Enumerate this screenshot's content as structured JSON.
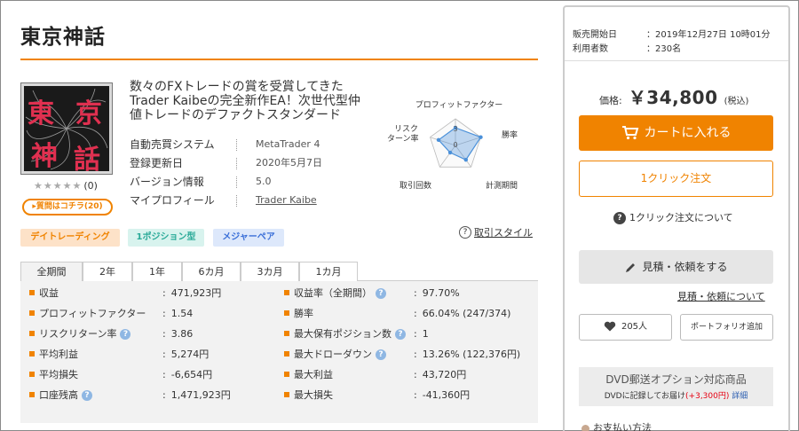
{
  "product": {
    "title": "東京神話",
    "thumbnail_text": "東京神話",
    "rating": {
      "stars": 0,
      "max_stars": 5,
      "review_count": "(0)"
    },
    "question_button": "質問はコチラ(20)",
    "description": "数々のFXトレードの賞を受賞してきたTrader Kaibeの完全新作EA！次世代型仲値トレードのデファクトスタンダード",
    "info": [
      {
        "label": "自動売買システム",
        "value": "MetaTrader 4"
      },
      {
        "label": "登録更新日",
        "value": "2020年5月7日"
      },
      {
        "label": "バージョン情報",
        "value": "5.0"
      },
      {
        "label": "マイプロフィール",
        "value": "Trader Kaibe"
      }
    ],
    "radar": {
      "axes": [
        "プロフィットファクター",
        "勝率",
        "計測期間",
        "取引回数",
        "リスク\nターン率"
      ],
      "values": [
        2,
        3,
        2,
        1,
        2
      ],
      "max": 3,
      "tick_labels": [
        "3",
        "0"
      ]
    },
    "tags": [
      "デイトレーディング",
      "1ポジション型",
      "メジャーペア"
    ],
    "trade_style_link": "取引スタイル",
    "tabs": [
      "全期間",
      "2年",
      "1年",
      "6カ月",
      "3カ月",
      "1カ月"
    ],
    "active_tab": "全期間",
    "stats": [
      {
        "left_label": "収益",
        "left_help": false,
        "left_value": "471,923円",
        "right_label": "収益率（全期間）",
        "right_help": true,
        "right_value": "97.70%"
      },
      {
        "left_label": "プロフィットファクター",
        "left_help": false,
        "left_value": "1.54",
        "right_label": "勝率",
        "right_help": false,
        "right_value": "66.04% (247/374)"
      },
      {
        "left_label": "リスクリターン率",
        "left_help": true,
        "left_value": "3.86",
        "right_label": "最大保有ポジション数",
        "right_help": true,
        "right_value": "1"
      },
      {
        "left_label": "平均利益",
        "left_help": false,
        "left_value": "5,274円",
        "right_label": "最大ドローダウン",
        "right_help": true,
        "right_value": "13.26% (122,376円)"
      },
      {
        "left_label": "平均損失",
        "left_help": false,
        "left_value": "-6,654円",
        "right_label": "最大利益",
        "right_help": false,
        "right_value": "43,720円"
      },
      {
        "left_label": "口座残高",
        "left_help": true,
        "left_value": "1,471,923円",
        "right_label": "最大損失",
        "right_help": false,
        "right_value": "-41,360円"
      }
    ],
    "separator": ":"
  },
  "sidebar": {
    "release_label": "販売開始日",
    "release_value": "2019年12月27日 10時01分",
    "users_label": "利用者数",
    "users_value": "230名",
    "colon": "：",
    "price_label": "価格:",
    "price_value": "￥34,800",
    "price_tax": "(税込)",
    "cart_button": "カートに入れる",
    "one_click_button": "1クリック注文",
    "one_click_about": "1クリック注文について",
    "quote_button": "見積・依頼をする",
    "quote_about": "見積・依頼について",
    "like_count": "205人",
    "portfolio_button": "ポートフォリオ追加",
    "dvd_title": "DVD郵送オプション対応商品",
    "dvd_text": "DVDに記録してお届け",
    "dvd_price": "(+3,300円)",
    "dvd_detail": "詳細",
    "payment_label": "お支払い方法",
    "help_glyph": "?"
  },
  "colors": {
    "accent": "#f08300",
    "help": "#8fb7e3",
    "radar": "#4a90d9"
  }
}
